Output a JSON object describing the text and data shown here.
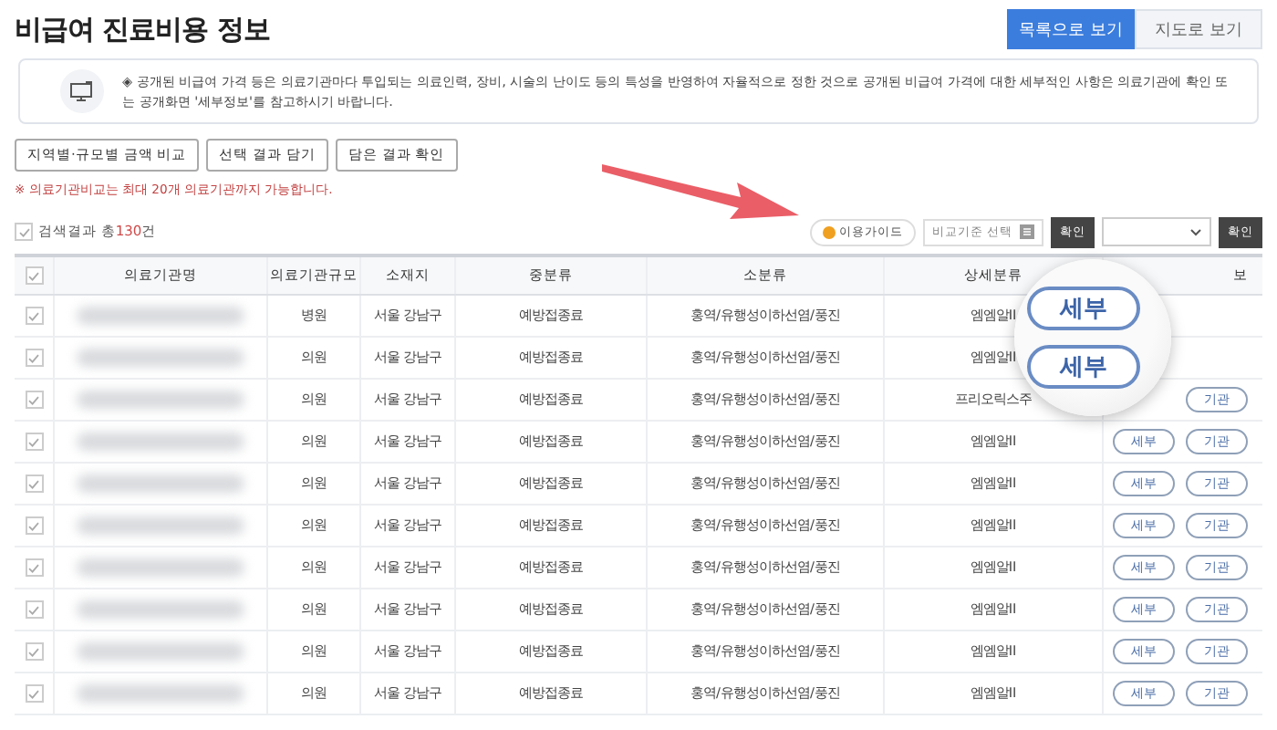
{
  "title": "비급여 진료비용 정보",
  "view_tabs": [
    {
      "label": "목록으로 보기",
      "selected": true
    },
    {
      "label": "지도로 보기",
      "selected": false
    }
  ],
  "notice": "◈ 공개된 비급여 가격 등은 의료기관마다 투입되는 의료인력, 장비, 시술의 난이도 등의 특성을 반영하여 자율적으로 정한 것으로 공개된 비급여 가격에 대한 세부적인 사항은 의료기관에 확인 또는 공개화면 '세부정보'를 참고하시기 바랍니다.",
  "actions": [
    "지역별·규모별 금액 비교",
    "선택 결과 담기",
    "담은 결과 확인"
  ],
  "warning": "※ 의료기관비교는 최대 20개 의료기관까지 가능합니다.",
  "result": {
    "checked": true,
    "label": "검색결과 총",
    "count": "130",
    "suffix": "건"
  },
  "toolbar": {
    "guide": "이용가이드",
    "criteria": "비교기준 선택",
    "confirm_1": "확인",
    "confirm_2": "확인"
  },
  "table": {
    "header_checked": true,
    "columns": [
      "의료기관명",
      "의료기관규모",
      "소재지",
      "중분류",
      "소분류",
      "상세분류",
      "보"
    ],
    "rows": [
      {
        "checked": true,
        "size": "병원",
        "location": "서울 강남구",
        "mid": "예방접종료",
        "small": "홍역/유행성이하선염/풍진",
        "detail": "엠엠알II"
      },
      {
        "checked": true,
        "size": "의원",
        "location": "서울 강남구",
        "mid": "예방접종료",
        "small": "홍역/유행성이하선염/풍진",
        "detail": "엠엠알II"
      },
      {
        "checked": true,
        "size": "의원",
        "location": "서울 강남구",
        "mid": "예방접종료",
        "small": "홍역/유행성이하선염/풍진",
        "detail": "프리오릭스주",
        "agency_button": "기관"
      },
      {
        "checked": true,
        "size": "의원",
        "location": "서울 강남구",
        "mid": "예방접종료",
        "small": "홍역/유행성이하선염/풍진",
        "detail": "엠엠알II",
        "detail_button": "세부",
        "agency_button": "기관"
      },
      {
        "checked": true,
        "size": "의원",
        "location": "서울 강남구",
        "mid": "예방접종료",
        "small": "홍역/유행성이하선염/풍진",
        "detail": "엠엠알II",
        "detail_button": "세부",
        "agency_button": "기관"
      },
      {
        "checked": true,
        "size": "의원",
        "location": "서울 강남구",
        "mid": "예방접종료",
        "small": "홍역/유행성이하선염/풍진",
        "detail": "엠엠알II",
        "detail_button": "세부",
        "agency_button": "기관"
      },
      {
        "checked": true,
        "size": "의원",
        "location": "서울 강남구",
        "mid": "예방접종료",
        "small": "홍역/유행성이하선염/풍진",
        "detail": "엠엠알II",
        "detail_button": "세부",
        "agency_button": "기관"
      },
      {
        "checked": true,
        "size": "의원",
        "location": "서울 강남구",
        "mid": "예방접종료",
        "small": "홍역/유행성이하선염/풍진",
        "detail": "엠엠알II",
        "detail_button": "세부",
        "agency_button": "기관"
      },
      {
        "checked": true,
        "size": "의원",
        "location": "서울 강남구",
        "mid": "예방접종료",
        "small": "홍역/유행성이하선염/풍진",
        "detail": "엠엠알II",
        "detail_button": "세부",
        "agency_button": "기관"
      },
      {
        "checked": true,
        "size": "의원",
        "location": "서울 강남구",
        "mid": "예방접종료",
        "small": "홍역/유행성이하선염/풍진",
        "detail": "엠엠알II",
        "detail_button": "세부",
        "agency_button": "기관"
      }
    ]
  },
  "magnifier": {
    "buttons": [
      "세부",
      "세부"
    ]
  }
}
